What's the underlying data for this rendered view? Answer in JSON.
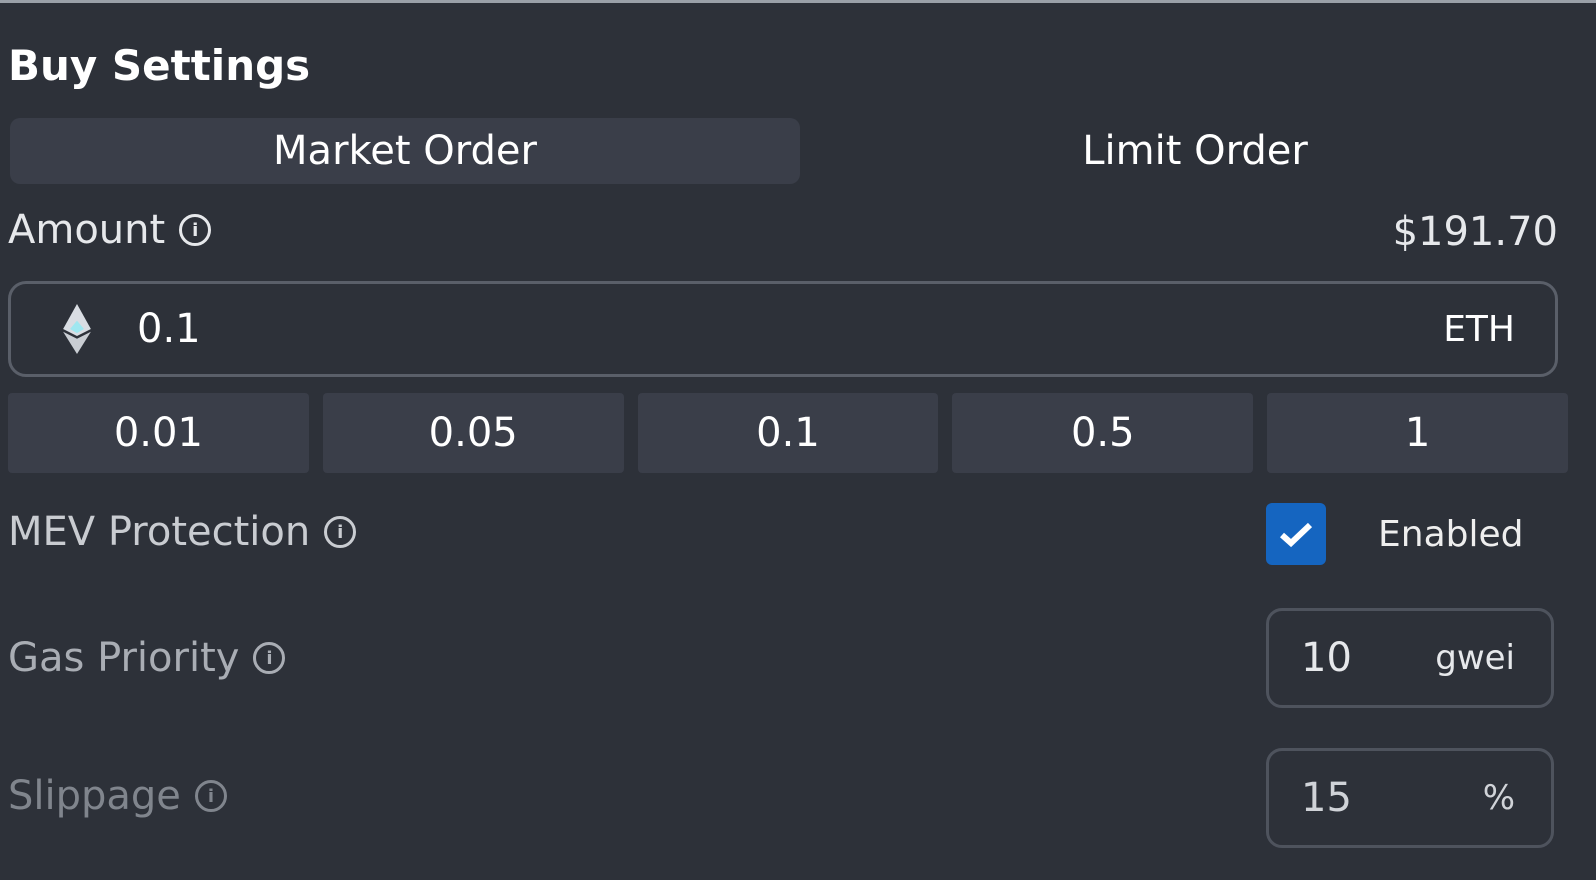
{
  "panel": {
    "title": "Buy Settings"
  },
  "order_tabs": {
    "active": "Market Order",
    "inactive": "Limit Order"
  },
  "amount": {
    "label": "Amount",
    "usd_value": "$191.70",
    "value": "0.1",
    "unit": "ETH",
    "icon": "ethereum-icon",
    "presets": [
      "0.01",
      "0.05",
      "0.1",
      "0.5",
      "1"
    ]
  },
  "mev_protection": {
    "label": "MEV Protection",
    "checked": true,
    "status": "Enabled",
    "accent": "#1565c0"
  },
  "gas_priority": {
    "label": "Gas Priority",
    "value": "10",
    "unit": "gwei"
  },
  "slippage": {
    "label": "Slippage",
    "value": "15",
    "unit": "%"
  },
  "info_icon": "i"
}
